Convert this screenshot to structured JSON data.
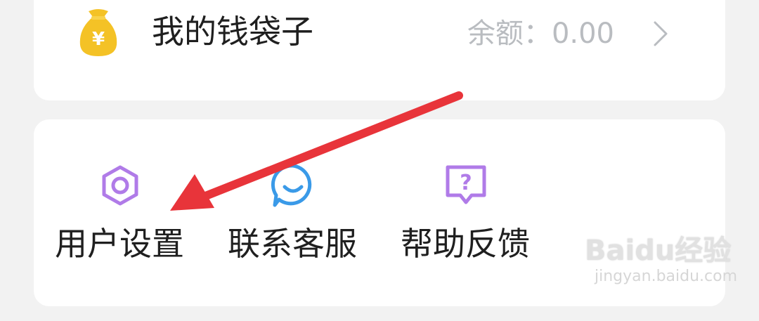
{
  "wallet": {
    "title": "我的钱袋子",
    "balance_label": "余额：",
    "balance_value": "0.00",
    "icon": "money-bag-icon",
    "chevron_icon": "chevron-right-icon"
  },
  "services": {
    "items": [
      {
        "label": "用户设置",
        "icon": "settings-hexagon-icon",
        "color": "#b07be8"
      },
      {
        "label": "联系客服",
        "icon": "chat-bubble-icon",
        "color": "#3a9ae8"
      },
      {
        "label": "帮助反馈",
        "icon": "help-question-icon",
        "color": "#b07be8"
      }
    ]
  },
  "watermark": {
    "logo_text": "Baidu经验",
    "url": "jingyan.baidu.com"
  },
  "colors": {
    "background": "#f2f2f2",
    "card": "#ffffff",
    "wallet_icon_yellow": "#f4c226",
    "annotation_arrow": "#e8343a"
  }
}
